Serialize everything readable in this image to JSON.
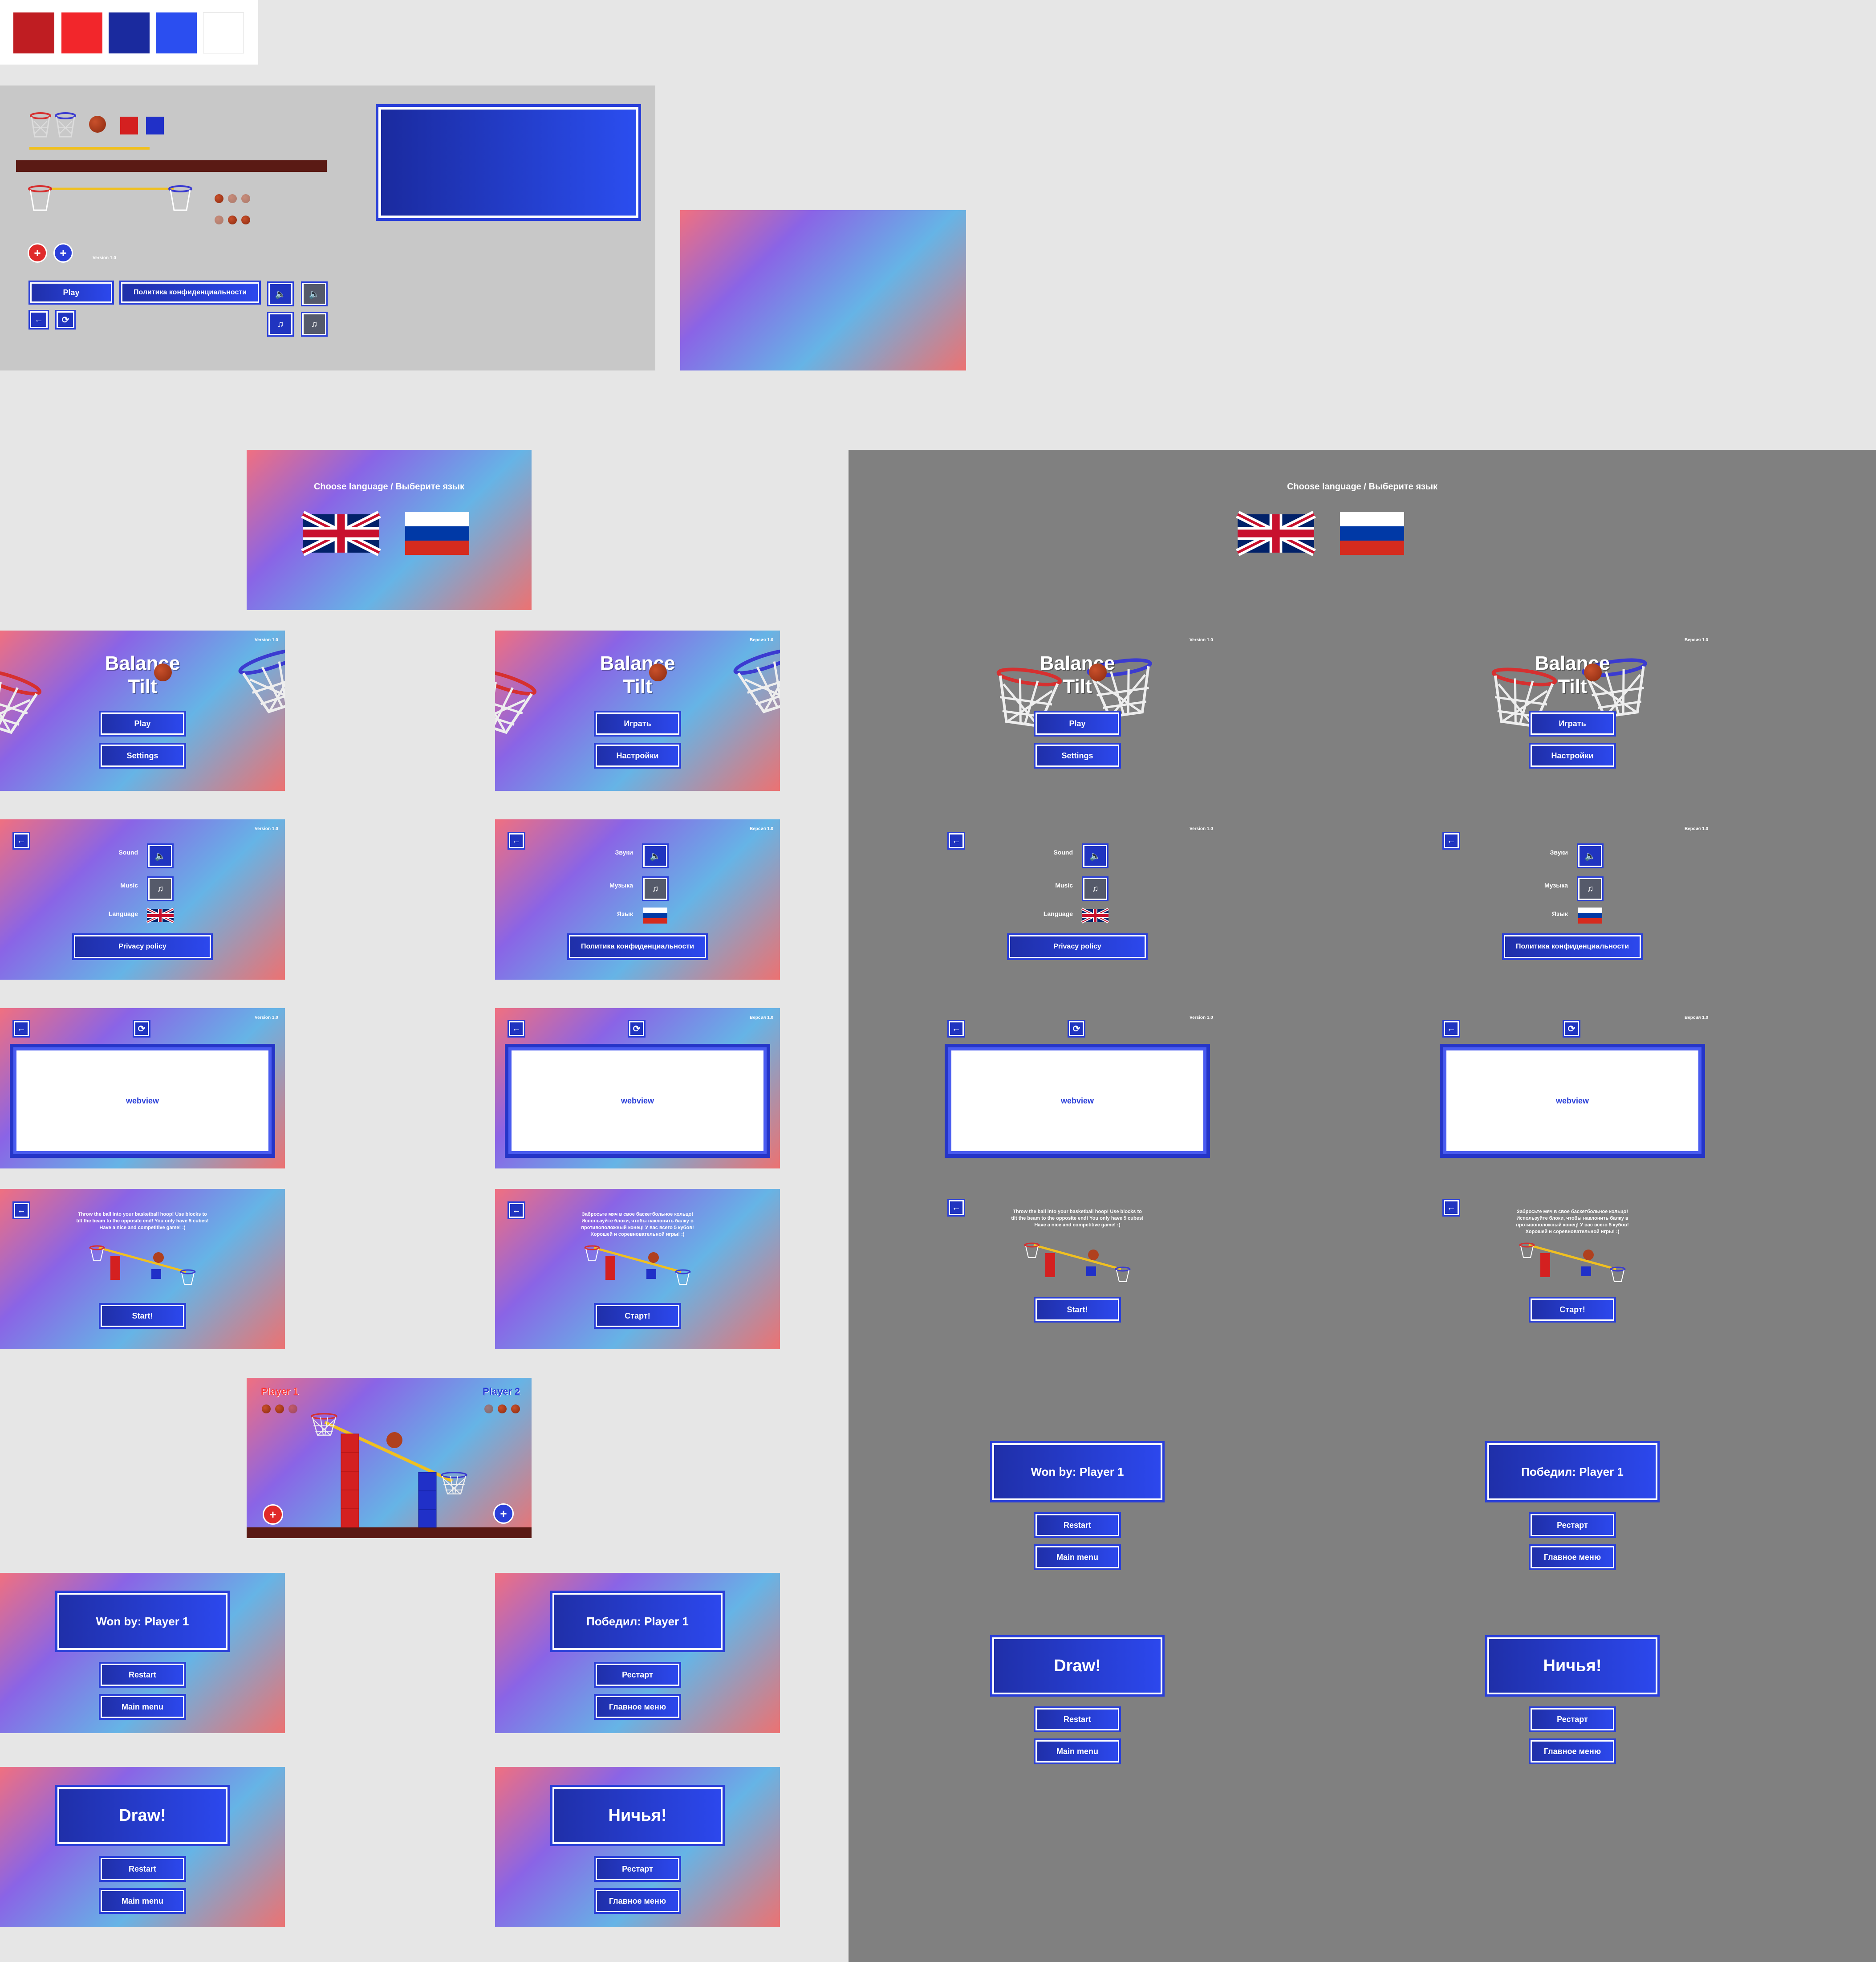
{
  "palette": {
    "colors": [
      "#bf1d22",
      "#f2262b",
      "#1a2a9e",
      "#2b4ef0",
      "#ffffff"
    ],
    "red": "#e02a2a",
    "blue": "#2a3fd8",
    "dark_bg": "#808080"
  },
  "icons": {
    "back": "←",
    "refresh": "⟳",
    "sound": "🔈",
    "music": "♫",
    "plus": "+"
  },
  "common": {
    "choose_language": "Choose language / Выберите язык",
    "webview": "webview"
  },
  "en": {
    "version": "Version 1.0",
    "title_line1": "Balance",
    "title_line2": "Tilt",
    "play": "Play",
    "settings": "Settings",
    "sound": "Sound",
    "music": "Music",
    "language": "Language",
    "privacy": "Privacy policy",
    "tutorial_text": "Throw the ball into your basketball hoop! Use blocks to tilt the beam to the opposite end! You only have 5 cubes! Have a nice and competitive game! :)",
    "start": "Start!",
    "won_by": "Won by: Player 1",
    "restart": "Restart",
    "main_menu": "Main menu",
    "draw": "Draw!"
  },
  "ru": {
    "version": "Версия 1.0",
    "play": "Играть",
    "settings": "Настройки",
    "sound": "Звуки",
    "music": "Музыка",
    "language": "Язык",
    "privacy": "Политика конфиденциальности",
    "tutorial_text": "Забросьте мяч в свое баскетбольное кольцо! Используйте блоки, чтобы наклонить балку в противоположный конец! У вас всего 5 кубов! Хорошей и соревновательной игры! :)",
    "start": "Старт!",
    "won_by": "Победил: Player 1",
    "restart": "Рестарт",
    "main_menu": "Главное меню",
    "draw": "Ничья!"
  },
  "sheet": {
    "play": "Play",
    "privacy": "Политика конфиденциальности",
    "version": "Version 1.0"
  },
  "game": {
    "player1": "Player 1",
    "player2": "Player 2",
    "player1_balls": 3,
    "player2_balls": 3
  }
}
